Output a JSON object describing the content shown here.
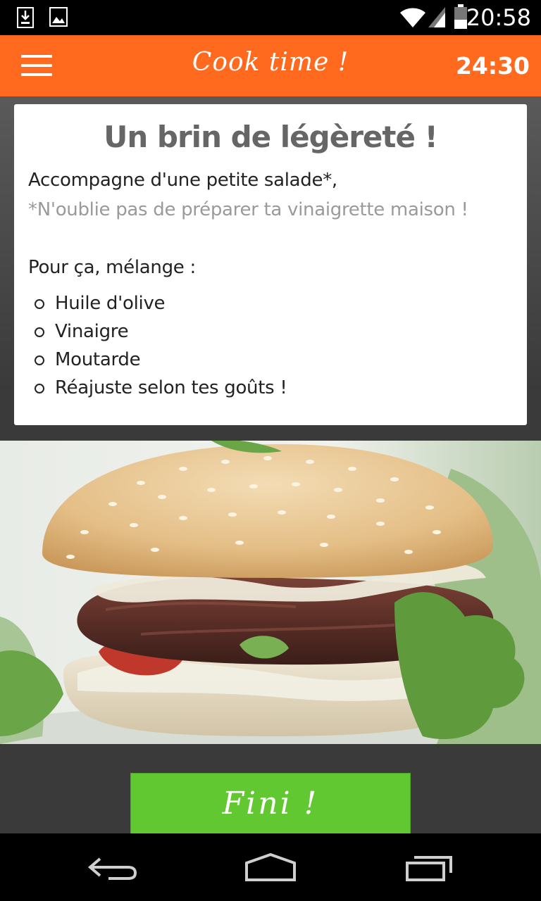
{
  "status_bar": {
    "time": "20:58",
    "icons": [
      "download-icon",
      "image-icon",
      "wifi-icon",
      "signal-icon",
      "battery-icon"
    ]
  },
  "app_bar": {
    "title": "Cook time !",
    "timer": "24:30",
    "menu_icon": "hamburger-menu-icon"
  },
  "card": {
    "title": "Un brin de légèreté !",
    "line1": "Accompagne d'une petite salade*,",
    "note": "*N'oublie pas de préparer ta vinaigrette maison !",
    "intro": "Pour ça, mélange :",
    "items": [
      "Huile d'olive",
      "Vinaigre",
      "Moutarde",
      "Réajuste selon tes goûts !"
    ]
  },
  "image": {
    "subject": "burger-photo"
  },
  "finish_button": {
    "label": "Fini !"
  },
  "nav_bar": {
    "icons": [
      "back-icon",
      "home-icon",
      "recents-icon"
    ]
  },
  "colors": {
    "accent": "#ff6a1f",
    "button": "#62c832"
  }
}
